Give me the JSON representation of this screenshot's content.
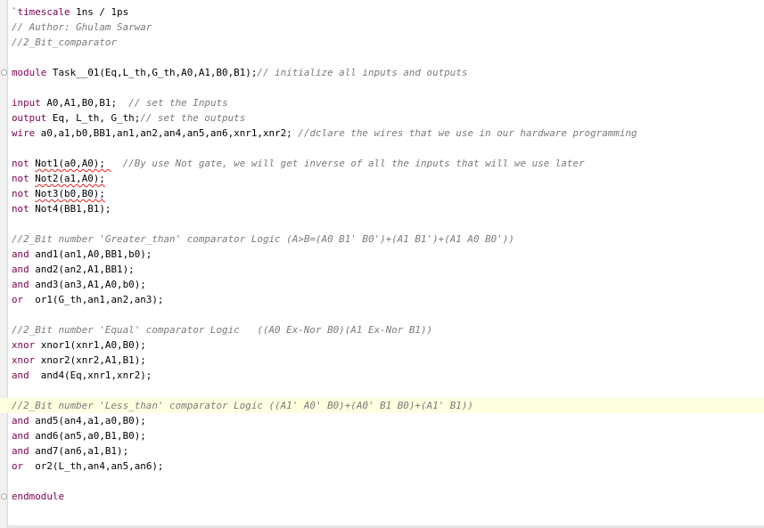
{
  "editor": {
    "current_line_index": 26,
    "current_line_color": "#ffffe0",
    "colors": {
      "keyword": "#7f0055",
      "comment": "#7a7a7a",
      "text": "#000000",
      "error_underline": "#e02020"
    },
    "fold_marker_lines": [
      4,
      32
    ],
    "lines": [
      {
        "tokens": [
          {
            "t": "dir",
            "v": "`timescale"
          },
          {
            "t": "txt",
            "v": " 1ns / 1ps"
          }
        ]
      },
      {
        "tokens": [
          {
            "t": "cm",
            "v": "// Author: Ghulam Sarwar"
          }
        ]
      },
      {
        "tokens": [
          {
            "t": "cm",
            "v": "//2_Bit_comparator"
          }
        ]
      },
      {
        "tokens": []
      },
      {
        "tokens": [
          {
            "t": "kw",
            "v": "module"
          },
          {
            "t": "txt",
            "v": " Task__01(Eq,L_th,G_th,A0,A1,B0,B1);"
          },
          {
            "t": "cm",
            "v": "// initialize all inputs and outputs"
          }
        ]
      },
      {
        "tokens": []
      },
      {
        "tokens": [
          {
            "t": "kw",
            "v": "input"
          },
          {
            "t": "txt",
            "v": " A0,A1,B0,B1;  "
          },
          {
            "t": "cm",
            "v": "// set the Inputs"
          }
        ]
      },
      {
        "tokens": [
          {
            "t": "kw",
            "v": "output"
          },
          {
            "t": "txt",
            "v": " Eq, L_th, G_th;"
          },
          {
            "t": "cm",
            "v": "// set the outputs"
          }
        ]
      },
      {
        "tokens": [
          {
            "t": "kw",
            "v": "wire"
          },
          {
            "t": "txt",
            "v": " a0,a1,b0,BB1,an1,an2,an4,an5,an6,xnr1,xnr2; "
          },
          {
            "t": "cm",
            "v": "//dclare the wires that we use in our hardware programming"
          }
        ]
      },
      {
        "tokens": []
      },
      {
        "tokens": [
          {
            "t": "kw",
            "v": "not"
          },
          {
            "t": "txt",
            "v": " "
          },
          {
            "t": "err",
            "v": "Not1(a0,A0); "
          },
          {
            "t": "txt",
            "v": "  "
          },
          {
            "t": "cm",
            "v": "//By use Not gate, we will get inverse of all the inputs that will we use later"
          }
        ]
      },
      {
        "tokens": [
          {
            "t": "kw",
            "v": "not"
          },
          {
            "t": "txt",
            "v": " "
          },
          {
            "t": "err",
            "v": "Not2(a1,A0);"
          }
        ]
      },
      {
        "tokens": [
          {
            "t": "kw",
            "v": "not"
          },
          {
            "t": "txt",
            "v": " "
          },
          {
            "t": "err",
            "v": "Not3(b0,B0);"
          }
        ]
      },
      {
        "tokens": [
          {
            "t": "kw",
            "v": "not"
          },
          {
            "t": "txt",
            "v": " Not4(BB1,B1);"
          }
        ]
      },
      {
        "tokens": []
      },
      {
        "tokens": [
          {
            "t": "cm",
            "v": "//2_Bit number 'Greater_than' comparator Logic (A>B=(A0 B1' B0')+(A1 B1')+(A1 A0 B0'))"
          }
        ]
      },
      {
        "tokens": [
          {
            "t": "kw",
            "v": "and"
          },
          {
            "t": "txt",
            "v": " and1(an1,A0,BB1,b0);"
          }
        ]
      },
      {
        "tokens": [
          {
            "t": "kw",
            "v": "and"
          },
          {
            "t": "txt",
            "v": " and2(an2,A1,BB1);"
          }
        ]
      },
      {
        "tokens": [
          {
            "t": "kw",
            "v": "and"
          },
          {
            "t": "txt",
            "v": " and3(an3,A1,A0,b0);"
          }
        ]
      },
      {
        "tokens": [
          {
            "t": "kw",
            "v": "or"
          },
          {
            "t": "txt",
            "v": "  or1(G_th,an1,an2,an3);"
          }
        ]
      },
      {
        "tokens": []
      },
      {
        "tokens": [
          {
            "t": "cm",
            "v": "//2_Bit number 'Equal' comparator Logic   ((A0 Ex-Nor B0)(A1 Ex-Nor B1))"
          }
        ]
      },
      {
        "tokens": [
          {
            "t": "kw",
            "v": "xnor"
          },
          {
            "t": "txt",
            "v": " xnor1(xnr1,A0,B0);"
          }
        ]
      },
      {
        "tokens": [
          {
            "t": "kw",
            "v": "xnor"
          },
          {
            "t": "txt",
            "v": " xnor2(xnr2,A1,B1);"
          }
        ]
      },
      {
        "tokens": [
          {
            "t": "kw",
            "v": "and"
          },
          {
            "t": "txt",
            "v": "  and4(Eq,xnr1,xnr2);"
          }
        ]
      },
      {
        "tokens": []
      },
      {
        "tokens": [
          {
            "t": "cm",
            "v": "//2_Bit number 'Less_than' comparator Logic ((A1' A0' B0)+(A0' B1 B0)+(A1' B1))"
          }
        ]
      },
      {
        "tokens": [
          {
            "t": "kw",
            "v": "and"
          },
          {
            "t": "txt",
            "v": " and5(an4,a1,a0,B0);"
          }
        ]
      },
      {
        "tokens": [
          {
            "t": "kw",
            "v": "and"
          },
          {
            "t": "txt",
            "v": " and6(an5,a0,B1,B0);"
          }
        ]
      },
      {
        "tokens": [
          {
            "t": "kw",
            "v": "and"
          },
          {
            "t": "txt",
            "v": " and7(an6,a1,B1);"
          }
        ]
      },
      {
        "tokens": [
          {
            "t": "kw",
            "v": "or"
          },
          {
            "t": "txt",
            "v": "  or2(L_th,an4,an5,an6);"
          }
        ]
      },
      {
        "tokens": []
      },
      {
        "tokens": [
          {
            "t": "kw",
            "v": "endmodule"
          }
        ]
      }
    ]
  }
}
